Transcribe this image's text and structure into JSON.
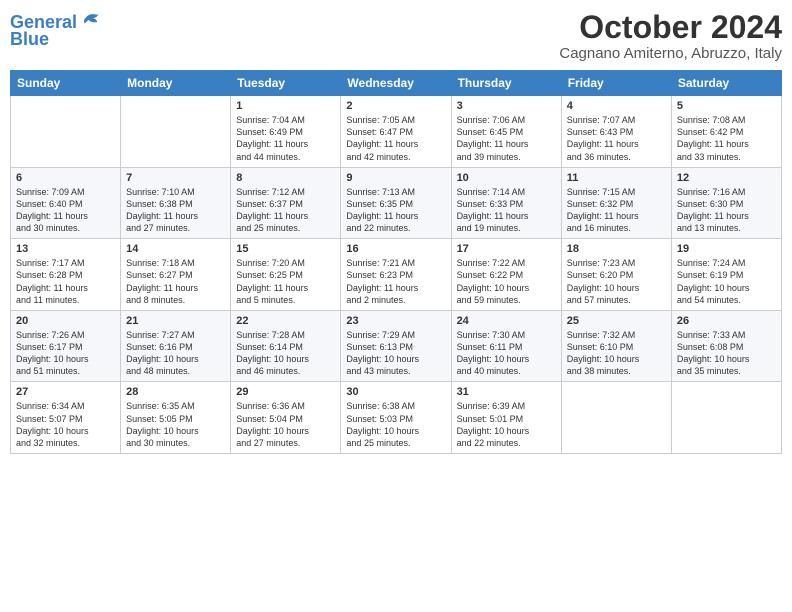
{
  "header": {
    "logo_line1": "General",
    "logo_line2": "Blue",
    "month_title": "October 2024",
    "location": "Cagnano Amiterno, Abruzzo, Italy"
  },
  "days_of_week": [
    "Sunday",
    "Monday",
    "Tuesday",
    "Wednesday",
    "Thursday",
    "Friday",
    "Saturday"
  ],
  "weeks": [
    [
      {
        "day": "",
        "info": ""
      },
      {
        "day": "",
        "info": ""
      },
      {
        "day": "1",
        "info": "Sunrise: 7:04 AM\nSunset: 6:49 PM\nDaylight: 11 hours\nand 44 minutes."
      },
      {
        "day": "2",
        "info": "Sunrise: 7:05 AM\nSunset: 6:47 PM\nDaylight: 11 hours\nand 42 minutes."
      },
      {
        "day": "3",
        "info": "Sunrise: 7:06 AM\nSunset: 6:45 PM\nDaylight: 11 hours\nand 39 minutes."
      },
      {
        "day": "4",
        "info": "Sunrise: 7:07 AM\nSunset: 6:43 PM\nDaylight: 11 hours\nand 36 minutes."
      },
      {
        "day": "5",
        "info": "Sunrise: 7:08 AM\nSunset: 6:42 PM\nDaylight: 11 hours\nand 33 minutes."
      }
    ],
    [
      {
        "day": "6",
        "info": "Sunrise: 7:09 AM\nSunset: 6:40 PM\nDaylight: 11 hours\nand 30 minutes."
      },
      {
        "day": "7",
        "info": "Sunrise: 7:10 AM\nSunset: 6:38 PM\nDaylight: 11 hours\nand 27 minutes."
      },
      {
        "day": "8",
        "info": "Sunrise: 7:12 AM\nSunset: 6:37 PM\nDaylight: 11 hours\nand 25 minutes."
      },
      {
        "day": "9",
        "info": "Sunrise: 7:13 AM\nSunset: 6:35 PM\nDaylight: 11 hours\nand 22 minutes."
      },
      {
        "day": "10",
        "info": "Sunrise: 7:14 AM\nSunset: 6:33 PM\nDaylight: 11 hours\nand 19 minutes."
      },
      {
        "day": "11",
        "info": "Sunrise: 7:15 AM\nSunset: 6:32 PM\nDaylight: 11 hours\nand 16 minutes."
      },
      {
        "day": "12",
        "info": "Sunrise: 7:16 AM\nSunset: 6:30 PM\nDaylight: 11 hours\nand 13 minutes."
      }
    ],
    [
      {
        "day": "13",
        "info": "Sunrise: 7:17 AM\nSunset: 6:28 PM\nDaylight: 11 hours\nand 11 minutes."
      },
      {
        "day": "14",
        "info": "Sunrise: 7:18 AM\nSunset: 6:27 PM\nDaylight: 11 hours\nand 8 minutes."
      },
      {
        "day": "15",
        "info": "Sunrise: 7:20 AM\nSunset: 6:25 PM\nDaylight: 11 hours\nand 5 minutes."
      },
      {
        "day": "16",
        "info": "Sunrise: 7:21 AM\nSunset: 6:23 PM\nDaylight: 11 hours\nand 2 minutes."
      },
      {
        "day": "17",
        "info": "Sunrise: 7:22 AM\nSunset: 6:22 PM\nDaylight: 10 hours\nand 59 minutes."
      },
      {
        "day": "18",
        "info": "Sunrise: 7:23 AM\nSunset: 6:20 PM\nDaylight: 10 hours\nand 57 minutes."
      },
      {
        "day": "19",
        "info": "Sunrise: 7:24 AM\nSunset: 6:19 PM\nDaylight: 10 hours\nand 54 minutes."
      }
    ],
    [
      {
        "day": "20",
        "info": "Sunrise: 7:26 AM\nSunset: 6:17 PM\nDaylight: 10 hours\nand 51 minutes."
      },
      {
        "day": "21",
        "info": "Sunrise: 7:27 AM\nSunset: 6:16 PM\nDaylight: 10 hours\nand 48 minutes."
      },
      {
        "day": "22",
        "info": "Sunrise: 7:28 AM\nSunset: 6:14 PM\nDaylight: 10 hours\nand 46 minutes."
      },
      {
        "day": "23",
        "info": "Sunrise: 7:29 AM\nSunset: 6:13 PM\nDaylight: 10 hours\nand 43 minutes."
      },
      {
        "day": "24",
        "info": "Sunrise: 7:30 AM\nSunset: 6:11 PM\nDaylight: 10 hours\nand 40 minutes."
      },
      {
        "day": "25",
        "info": "Sunrise: 7:32 AM\nSunset: 6:10 PM\nDaylight: 10 hours\nand 38 minutes."
      },
      {
        "day": "26",
        "info": "Sunrise: 7:33 AM\nSunset: 6:08 PM\nDaylight: 10 hours\nand 35 minutes."
      }
    ],
    [
      {
        "day": "27",
        "info": "Sunrise: 6:34 AM\nSunset: 5:07 PM\nDaylight: 10 hours\nand 32 minutes."
      },
      {
        "day": "28",
        "info": "Sunrise: 6:35 AM\nSunset: 5:05 PM\nDaylight: 10 hours\nand 30 minutes."
      },
      {
        "day": "29",
        "info": "Sunrise: 6:36 AM\nSunset: 5:04 PM\nDaylight: 10 hours\nand 27 minutes."
      },
      {
        "day": "30",
        "info": "Sunrise: 6:38 AM\nSunset: 5:03 PM\nDaylight: 10 hours\nand 25 minutes."
      },
      {
        "day": "31",
        "info": "Sunrise: 6:39 AM\nSunset: 5:01 PM\nDaylight: 10 hours\nand 22 minutes."
      },
      {
        "day": "",
        "info": ""
      },
      {
        "day": "",
        "info": ""
      }
    ]
  ]
}
